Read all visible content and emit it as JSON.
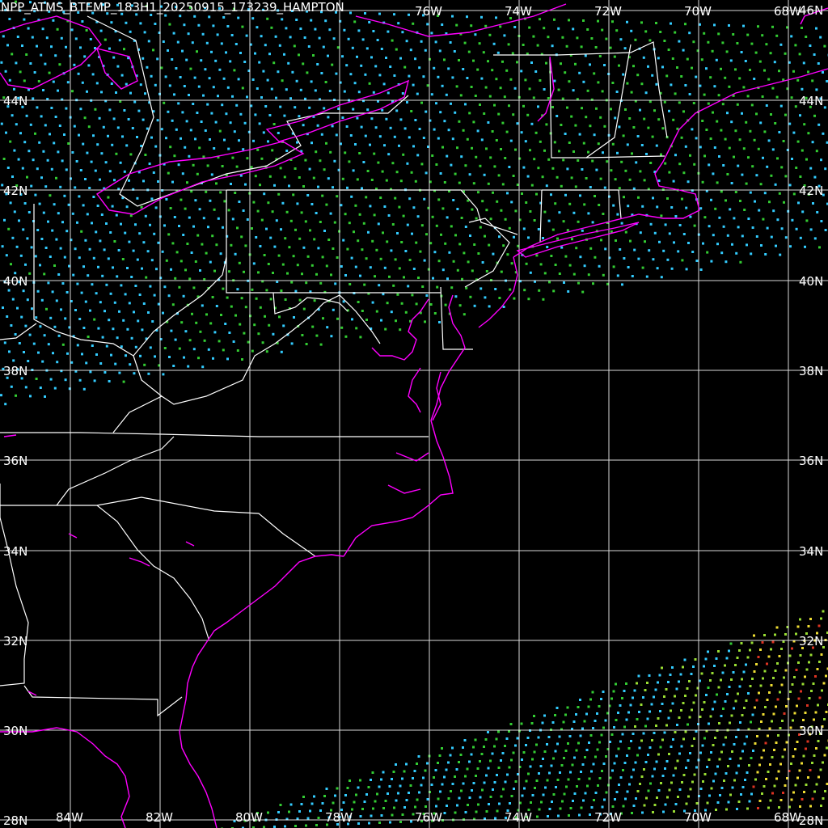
{
  "title": "NPP_ATMS_BTEMP_183H1_20250915_173239_HAMPTON",
  "colors": {
    "background": "#000000",
    "grid": "#ffffff",
    "coastline": "#ff00ff",
    "borders": "#ffffff",
    "pixel_cyan": "#33ccff",
    "pixel_green": "#33cc33",
    "pixel_lime": "#99dd33",
    "pixel_yellow": "#eedd33",
    "pixel_red": "#dd3322"
  },
  "lat_labels": [
    "44N",
    "42N",
    "40N",
    "38N",
    "36N",
    "34N",
    "32N",
    "30N",
    "28N"
  ],
  "lon_labels_top": [
    "76W",
    "74W",
    "72W",
    "70W",
    "68W"
  ],
  "lon_labels_bottom": [
    "84W",
    "82W",
    "80W",
    "78W",
    "76W",
    "74W",
    "72W",
    "70W",
    "68W"
  ],
  "top_right_lat": "46N"
}
